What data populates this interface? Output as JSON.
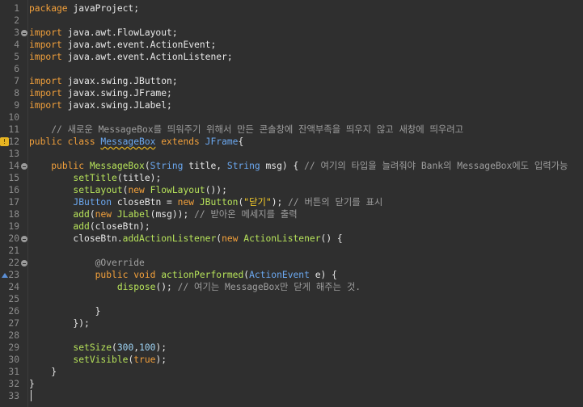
{
  "editor": {
    "line_numbers": [
      "1",
      "2",
      "3",
      "4",
      "5",
      "6",
      "7",
      "8",
      "9",
      "10",
      "11",
      "12",
      "13",
      "14",
      "15",
      "16",
      "17",
      "18",
      "19",
      "20",
      "21",
      "22",
      "23",
      "24",
      "25",
      "26",
      "27",
      "28",
      "29",
      "30",
      "31",
      "32",
      "33"
    ],
    "lines": [
      [
        [
          "kw",
          "package"
        ],
        [
          "tx",
          " javaProject;"
        ]
      ],
      [],
      [
        [
          "kw",
          "import"
        ],
        [
          "tx",
          " java.awt.FlowLayout;"
        ]
      ],
      [
        [
          "kw",
          "import"
        ],
        [
          "tx",
          " java.awt.event.ActionEvent;"
        ]
      ],
      [
        [
          "kw",
          "import"
        ],
        [
          "tx",
          " java.awt.event.ActionListener;"
        ]
      ],
      [],
      [
        [
          "kw",
          "import"
        ],
        [
          "tx",
          " javax.swing.JButton;"
        ]
      ],
      [
        [
          "kw",
          "import"
        ],
        [
          "tx",
          " javax.swing.JFrame;"
        ]
      ],
      [
        [
          "kw",
          "import"
        ],
        [
          "tx",
          " javax.swing.JLabel;"
        ]
      ],
      [],
      [
        [
          "tx",
          "    "
        ],
        [
          "cm",
          "// 새로운 MessageBox를 띄워주기 위해서 만든 콘솔창에 잔액부족을 띄우지 않고 새창에 띄우려고"
        ]
      ],
      [
        [
          "kw",
          "public class "
        ],
        [
          "ty",
          "MessageBox"
        ],
        [
          "tx",
          " "
        ],
        [
          "kw",
          "extends"
        ],
        [
          "tx",
          " "
        ],
        [
          "ty",
          "JFrame"
        ],
        [
          "tx",
          "{"
        ]
      ],
      [],
      [
        [
          "tx",
          "    "
        ],
        [
          "kw",
          "public "
        ],
        [
          "fn",
          "MessageBox"
        ],
        [
          "tx",
          "("
        ],
        [
          "ty",
          "String"
        ],
        [
          "tx",
          " title, "
        ],
        [
          "ty",
          "String"
        ],
        [
          "tx",
          " msg) { "
        ],
        [
          "cm",
          "// 여기의 타입을 늘려줘야 Bank의 MessageBox에도 입력가능"
        ]
      ],
      [
        [
          "tx",
          "        "
        ],
        [
          "fn",
          "setTitle"
        ],
        [
          "tx",
          "(title);"
        ]
      ],
      [
        [
          "tx",
          "        "
        ],
        [
          "fn",
          "setLayout"
        ],
        [
          "tx",
          "("
        ],
        [
          "kw",
          "new "
        ],
        [
          "fn",
          "FlowLayout"
        ],
        [
          "tx",
          "());"
        ]
      ],
      [
        [
          "tx",
          "        "
        ],
        [
          "ty",
          "JButton"
        ],
        [
          "tx",
          " closeBtn = "
        ],
        [
          "kw",
          "new "
        ],
        [
          "fn",
          "JButton"
        ],
        [
          "tx",
          "("
        ],
        [
          "st",
          "\"닫기\""
        ],
        [
          "tx",
          "); "
        ],
        [
          "cm",
          "// 버튼의 닫기를 표시"
        ]
      ],
      [
        [
          "tx",
          "        "
        ],
        [
          "fn",
          "add"
        ],
        [
          "tx",
          "("
        ],
        [
          "kw",
          "new "
        ],
        [
          "fn",
          "JLabel"
        ],
        [
          "tx",
          "(msg)); "
        ],
        [
          "cm",
          "// 받아온 메세지를 출력"
        ]
      ],
      [
        [
          "tx",
          "        "
        ],
        [
          "fn",
          "add"
        ],
        [
          "tx",
          "(closeBtn);"
        ]
      ],
      [
        [
          "tx",
          "        "
        ],
        [
          "tx",
          "closeBtn."
        ],
        [
          "fn",
          "addActionListener"
        ],
        [
          "tx",
          "("
        ],
        [
          "kw",
          "new "
        ],
        [
          "fn",
          "ActionListener"
        ],
        [
          "tx",
          "() {"
        ]
      ],
      [],
      [
        [
          "tx",
          "            "
        ],
        [
          "an",
          "@Override"
        ]
      ],
      [
        [
          "tx",
          "            "
        ],
        [
          "kw",
          "public void "
        ],
        [
          "fn",
          "actionPerformed"
        ],
        [
          "tx",
          "("
        ],
        [
          "ty",
          "ActionEvent"
        ],
        [
          "tx",
          " e) {"
        ]
      ],
      [
        [
          "tx",
          "                "
        ],
        [
          "fn",
          "dispose"
        ],
        [
          "tx",
          "(); "
        ],
        [
          "cm",
          "// 여기는 MessageBox만 닫게 해주는 것."
        ]
      ],
      [],
      [
        [
          "tx",
          "            }"
        ]
      ],
      [
        [
          "tx",
          "        });"
        ]
      ],
      [],
      [
        [
          "tx",
          "        "
        ],
        [
          "fn",
          "setSize"
        ],
        [
          "tx",
          "("
        ],
        [
          "nu",
          "300"
        ],
        [
          "tx",
          ","
        ],
        [
          "nu",
          "100"
        ],
        [
          "tx",
          ");"
        ]
      ],
      [
        [
          "tx",
          "        "
        ],
        [
          "fn",
          "setVisible"
        ],
        [
          "tx",
          "("
        ],
        [
          "kw",
          "true"
        ],
        [
          "tx",
          ");"
        ]
      ],
      [
        [
          "tx",
          "    }"
        ]
      ],
      [
        [
          "tx",
          "}"
        ]
      ],
      []
    ],
    "fold_lines": [
      3,
      14,
      20,
      22
    ],
    "warning_line": 12,
    "override_line": 23,
    "cursor_line": 33,
    "squiggle_token": "MessageBox",
    "icons": {
      "fold": "collapse-icon",
      "warning": "warning-lightbulb-icon",
      "override": "override-triangle-icon"
    },
    "colors": {
      "background": "#2f2f2f",
      "keyword": "#f2a03b",
      "comment": "#9e9e9e",
      "type": "#6ba8f0",
      "method": "#b7e35a",
      "string": "#ffd42a",
      "number": "#9ed4f5",
      "text": "#e8e8e8"
    }
  }
}
